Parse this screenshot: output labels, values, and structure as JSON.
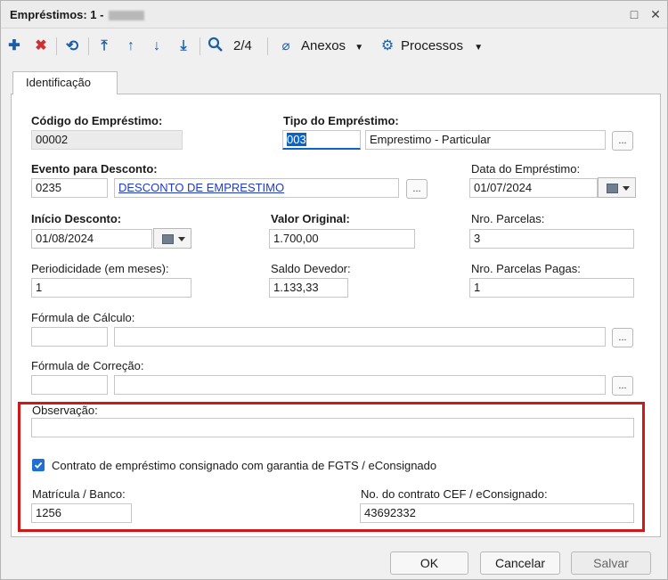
{
  "window": {
    "title": "Empréstimos: 1 -"
  },
  "toolbar": {
    "add_icon": "plus-icon",
    "delete_icon": "x-icon",
    "refresh_icon": "refresh-icon",
    "first_icon": "arrow-first-icon",
    "prev_icon": "arrow-up-icon",
    "next_icon": "arrow-down-icon",
    "last_icon": "arrow-last-icon",
    "search_icon": "search-icon",
    "record_counter": "2/4",
    "anexos_label": "Anexos",
    "processos_label": "Processos"
  },
  "tab": {
    "label": "Identificação"
  },
  "form": {
    "codigo": {
      "label": "Código do Empréstimo:",
      "value": "00002"
    },
    "tipo": {
      "label": "Tipo do Empréstimo:",
      "code": "003",
      "description": "Emprestimo - Particular"
    },
    "evento": {
      "label": "Evento para Desconto:",
      "code": "0235",
      "description": "DESCONTO DE EMPRESTIMO"
    },
    "data_emprestimo": {
      "label": "Data do Empréstimo:",
      "value": "01/07/2024"
    },
    "inicio_desconto": {
      "label": "Início Desconto:",
      "value": "01/08/2024"
    },
    "valor_original": {
      "label": "Valor Original:",
      "value": "1.700,00"
    },
    "nro_parcelas": {
      "label": "Nro. Parcelas:",
      "value": "3"
    },
    "periodicidade": {
      "label": "Periodicidade (em meses):",
      "value": "1"
    },
    "saldo_devedor": {
      "label": "Saldo Devedor:",
      "value": "1.133,33"
    },
    "parcelas_pagas": {
      "label": "Nro. Parcelas Pagas:",
      "value": "1"
    },
    "formula_calculo": {
      "label": "Fórmula de Cálculo:",
      "code": "",
      "description": ""
    },
    "formula_correcao": {
      "label": "Fórmula de Correção:",
      "code": "",
      "description": ""
    },
    "observacao": {
      "label": "Observação:",
      "value": ""
    },
    "consignado": {
      "label": "Contrato de empréstimo consignado com garantia de FGTS / eConsignado",
      "checked": true
    },
    "matricula": {
      "label": "Matrícula / Banco:",
      "value": "1256"
    },
    "contrato_cef": {
      "label": "No. do contrato CEF / eConsignado:",
      "value": "43692332"
    },
    "lookup_button_label": "..."
  },
  "buttons": {
    "ok": "OK",
    "cancel": "Cancelar",
    "save": "Salvar"
  },
  "colors": {
    "highlight_border": "#d11818",
    "link": "#1f3ad0",
    "checkbox": "#1e6fd6"
  }
}
